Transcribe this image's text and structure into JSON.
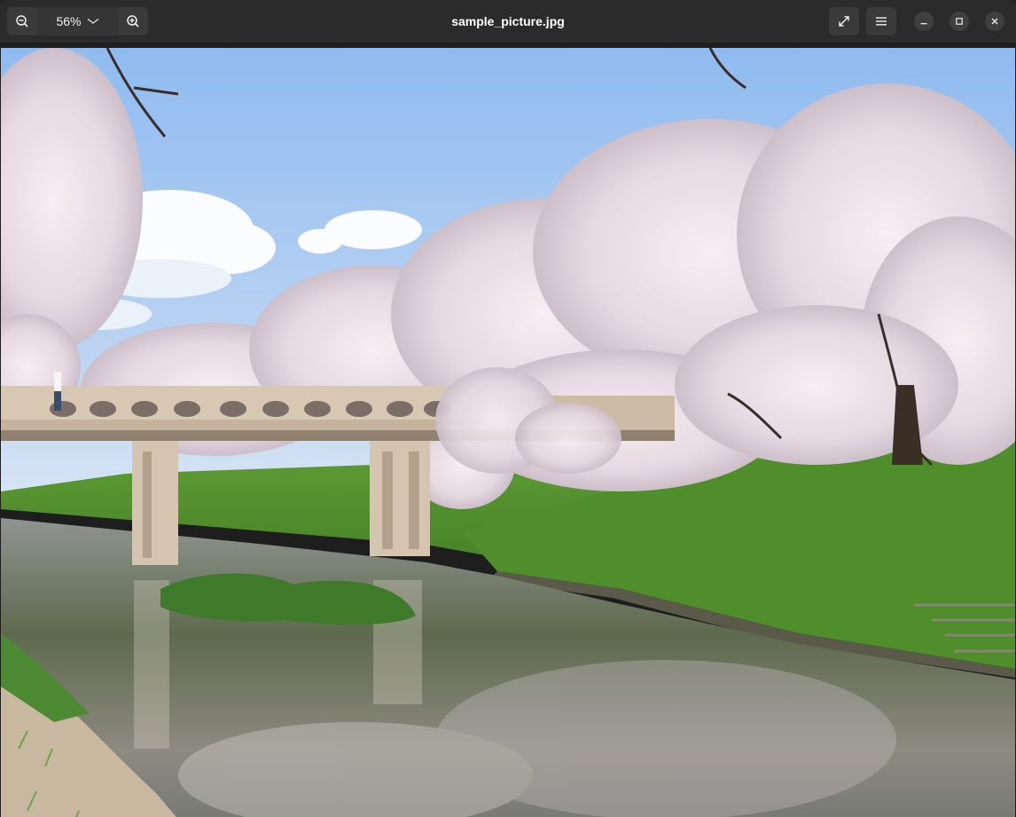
{
  "window": {
    "title": "sample_picture.jpg"
  },
  "toolbar": {
    "zoom_level": "56%",
    "zoom_out_icon": "zoom-out-icon",
    "zoom_in_icon": "zoom-in-icon",
    "dropdown_icon": "chevron-down-icon",
    "fullscreen_icon": "fullscreen-icon",
    "menu_icon": "hamburger-menu-icon"
  },
  "window_controls": {
    "minimize_icon": "minimize-icon",
    "maximize_icon": "maximize-icon",
    "close_icon": "close-icon"
  },
  "image": {
    "kind": "photo"
  },
  "colors": {
    "titlebar_bg": "#2b2b2b",
    "button_bg": "#3a3a3a",
    "sky": "#b9d3f3",
    "blossom": "#f1e7ee",
    "grass": "#4e8c2c",
    "water": "#6b6c62"
  }
}
